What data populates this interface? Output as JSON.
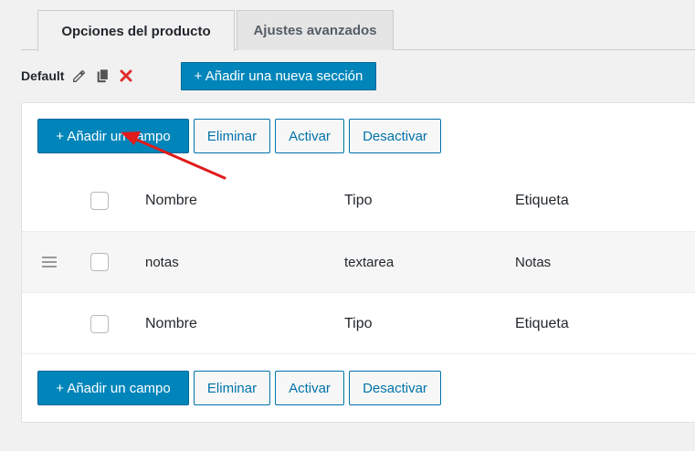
{
  "tabs": [
    {
      "label": "Opciones del producto",
      "active": true
    },
    {
      "label": "Ajustes avanzados",
      "active": false
    }
  ],
  "section": {
    "name": "Default",
    "icons": [
      "pencil-icon",
      "copy-icon",
      "delete-icon"
    ],
    "add_section_label": "+ Añadir una nueva sección"
  },
  "toolbar": {
    "add_field_label": "+ Añadir un campo",
    "delete_label": "Eliminar",
    "activate_label": "Activar",
    "deactivate_label": "Desactivar"
  },
  "table": {
    "columns": [
      "Nombre",
      "Tipo",
      "Etiqueta"
    ],
    "rows": [
      {
        "name": "notas",
        "type": "textarea",
        "label": "Notas"
      }
    ]
  },
  "colors": {
    "primary": "#0085ba",
    "secondary_text": "#0073aa",
    "delete_icon": "#e02c2c",
    "annotation_arrow": "#e01b1b"
  }
}
